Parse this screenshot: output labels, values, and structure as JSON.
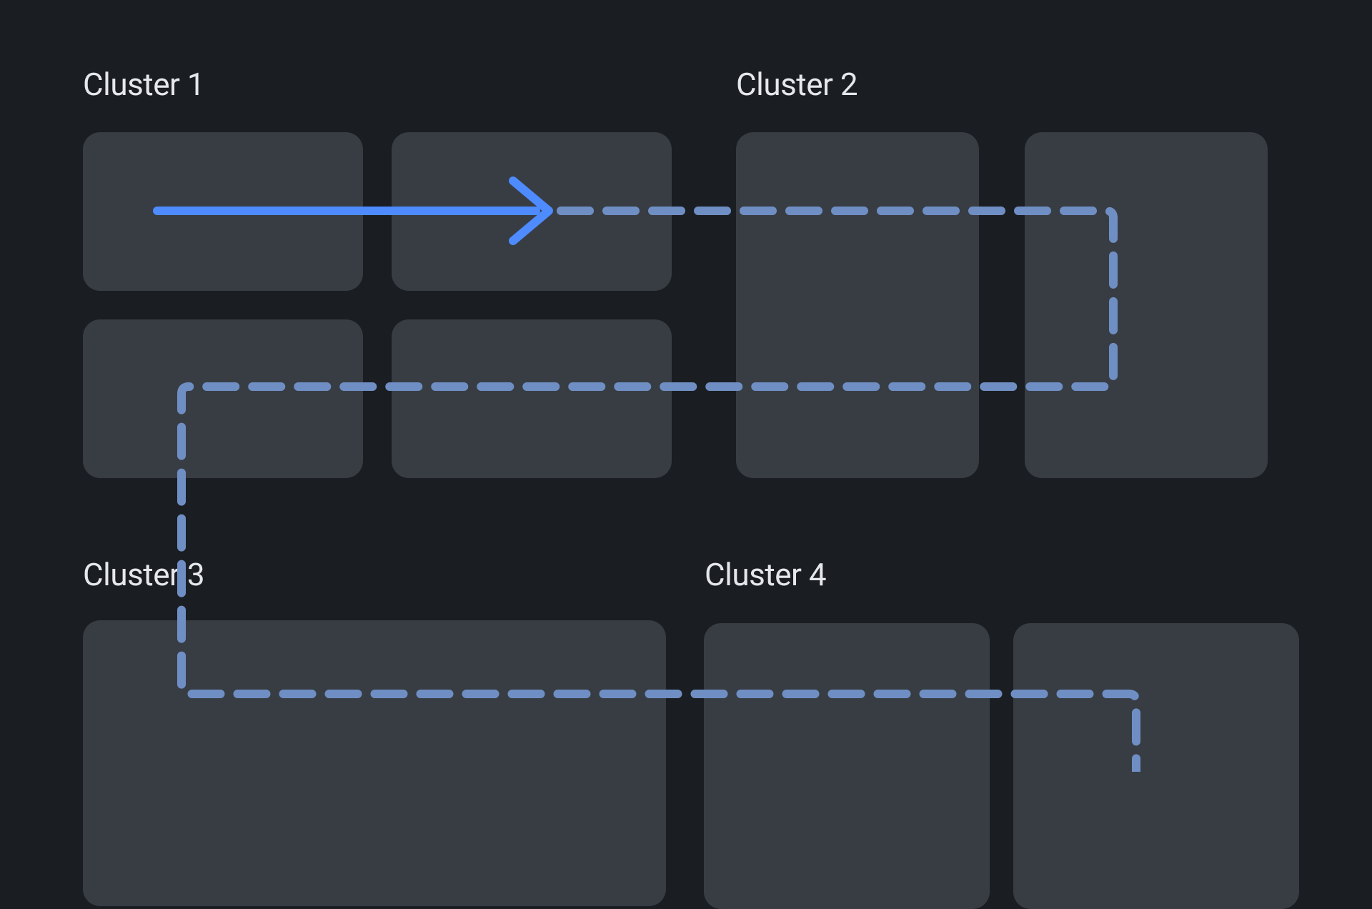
{
  "clusters": [
    {
      "id": "cluster-1",
      "label": "Cluster 1"
    },
    {
      "id": "cluster-2",
      "label": "Cluster 2"
    },
    {
      "id": "cluster-3",
      "label": "Cluster 3"
    },
    {
      "id": "cluster-4",
      "label": "Cluster 4"
    }
  ],
  "colors": {
    "background": "#1a1d21",
    "node": "#383d44",
    "label": "#e5e7eb",
    "arrow_solid": "#4d8bff",
    "arrow_dashed": "#6f8fc4"
  }
}
